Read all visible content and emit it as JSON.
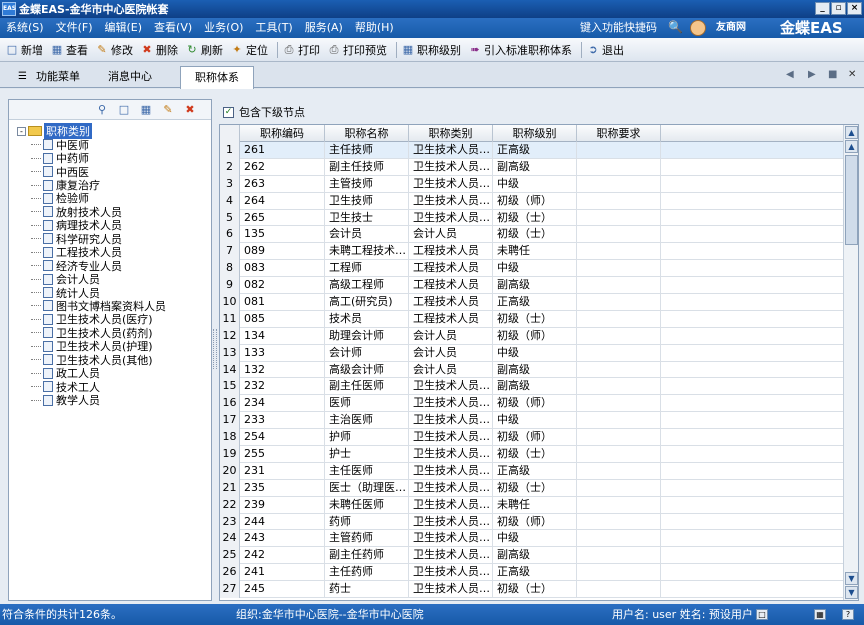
{
  "window": {
    "logo_text": "EAS",
    "title": "金蝶EAS-金华市中心医院帐套",
    "buttons": {
      "minimize": "_",
      "restore": "▫",
      "close": "×"
    }
  },
  "menubar": {
    "items": [
      "系统(S)",
      "文件(F)",
      "编辑(E)",
      "查看(V)",
      "业务(O)",
      "工具(T)",
      "服务(A)",
      "帮助(H)"
    ],
    "quick_search": "键入功能快捷码",
    "kingdee_net": "友商网",
    "brand": "金蝶EAS"
  },
  "toolbar": {
    "buttons": [
      {
        "label": "新增",
        "icon": "new-doc-icon"
      },
      {
        "label": "查看",
        "icon": "view-icon"
      },
      {
        "label": "修改",
        "icon": "edit-icon"
      },
      {
        "label": "删除",
        "icon": "delete-icon"
      },
      {
        "label": "刷新",
        "icon": "refresh-icon"
      },
      {
        "label": "定位",
        "icon": "locate-icon"
      },
      {
        "label": "打印",
        "icon": "print-icon"
      },
      {
        "label": "打印预览",
        "icon": "print-preview-icon"
      },
      {
        "label": "职称级别",
        "icon": "title-level-icon"
      },
      {
        "label": "引入标准职称体系",
        "icon": "import-icon"
      },
      {
        "label": "退出",
        "icon": "exit-icon"
      }
    ]
  },
  "tabs": [
    {
      "label": "功能菜单"
    },
    {
      "label": "消息中心"
    },
    {
      "label": "职称体系",
      "active": true
    }
  ],
  "tree": {
    "root": "职称类别",
    "items": [
      "中医师",
      "中药师",
      "中西医",
      "康复治疗",
      "检验师",
      "放射技术人员",
      "病理技术人员",
      "科学研究人员",
      "工程技术人员",
      "经济专业人员",
      "会计人员",
      "统计人员",
      "图书文博档案资料人员",
      "卫生技术人员(医疗)",
      "卫生技术人员(药剂)",
      "卫生技术人员(护理)",
      "卫生技术人员(其他)",
      "政工人员",
      "技术工人",
      "教学人员"
    ]
  },
  "grid": {
    "include_children_label": "包含下级节点",
    "include_children_checked": "✓",
    "headers": [
      "职称编码",
      "职称名称",
      "职称类别",
      "职称级别",
      "职称要求"
    ],
    "rows": [
      [
        "1",
        "261",
        "主任技师",
        "卫生技术人员(...",
        "正高级",
        ""
      ],
      [
        "2",
        "262",
        "副主任技师",
        "卫生技术人员(...",
        "副高级",
        ""
      ],
      [
        "3",
        "263",
        "主管技师",
        "卫生技术人员(...",
        "中级",
        ""
      ],
      [
        "4",
        "264",
        "卫生技师",
        "卫生技术人员(...",
        "初级（师）",
        ""
      ],
      [
        "5",
        "265",
        "卫生技士",
        "卫生技术人员(...",
        "初级（士）",
        ""
      ],
      [
        "6",
        "135",
        "会计员",
        "会计人员",
        "初级（士）",
        ""
      ],
      [
        "7",
        "089",
        "未聘工程技术人...",
        "工程技术人员",
        "未聘任",
        ""
      ],
      [
        "8",
        "083",
        "工程师",
        "工程技术人员",
        "中级",
        ""
      ],
      [
        "9",
        "082",
        "高级工程师",
        "工程技术人员",
        "副高级",
        ""
      ],
      [
        "10",
        "081",
        "高工(研究员)",
        "工程技术人员",
        "正高级",
        ""
      ],
      [
        "11",
        "085",
        "技术员",
        "工程技术人员",
        "初级（士）",
        ""
      ],
      [
        "12",
        "134",
        "助理会计师",
        "会计人员",
        "初级（师）",
        ""
      ],
      [
        "13",
        "133",
        "会计师",
        "会计人员",
        "中级",
        ""
      ],
      [
        "14",
        "132",
        "高级会计师",
        "会计人员",
        "副高级",
        ""
      ],
      [
        "15",
        "232",
        "副主任医师",
        "卫生技术人员(...",
        "副高级",
        ""
      ],
      [
        "16",
        "234",
        "医师",
        "卫生技术人员(...",
        "初级（师）",
        ""
      ],
      [
        "17",
        "233",
        "主治医师",
        "卫生技术人员(...",
        "中级",
        ""
      ],
      [
        "18",
        "254",
        "护师",
        "卫生技术人员(...",
        "初级（师）",
        ""
      ],
      [
        "19",
        "255",
        "护士",
        "卫生技术人员(...",
        "初级（士）",
        ""
      ],
      [
        "20",
        "231",
        "主任医师",
        "卫生技术人员(...",
        "正高级",
        ""
      ],
      [
        "21",
        "235",
        "医士（助理医师...",
        "卫生技术人员(...",
        "初级（士）",
        ""
      ],
      [
        "22",
        "239",
        "未聘任医师",
        "卫生技术人员(...",
        "未聘任",
        ""
      ],
      [
        "23",
        "244",
        "药师",
        "卫生技术人员(...",
        "初级（师）",
        ""
      ],
      [
        "24",
        "243",
        "主管药师",
        "卫生技术人员(...",
        "中级",
        ""
      ],
      [
        "25",
        "242",
        "副主任药师",
        "卫生技术人员(...",
        "副高级",
        ""
      ],
      [
        "26",
        "241",
        "主任药师",
        "卫生技术人员(...",
        "正高级",
        ""
      ],
      [
        "27",
        "245",
        "药士",
        "卫生技术人员(...",
        "初级（士）",
        ""
      ]
    ]
  },
  "statusbar": {
    "count": "符合条件的共计126条。",
    "org": "组织:金华市中心医院--金华市中心医院",
    "user": "用户名: user 姓名: 预设用户"
  }
}
